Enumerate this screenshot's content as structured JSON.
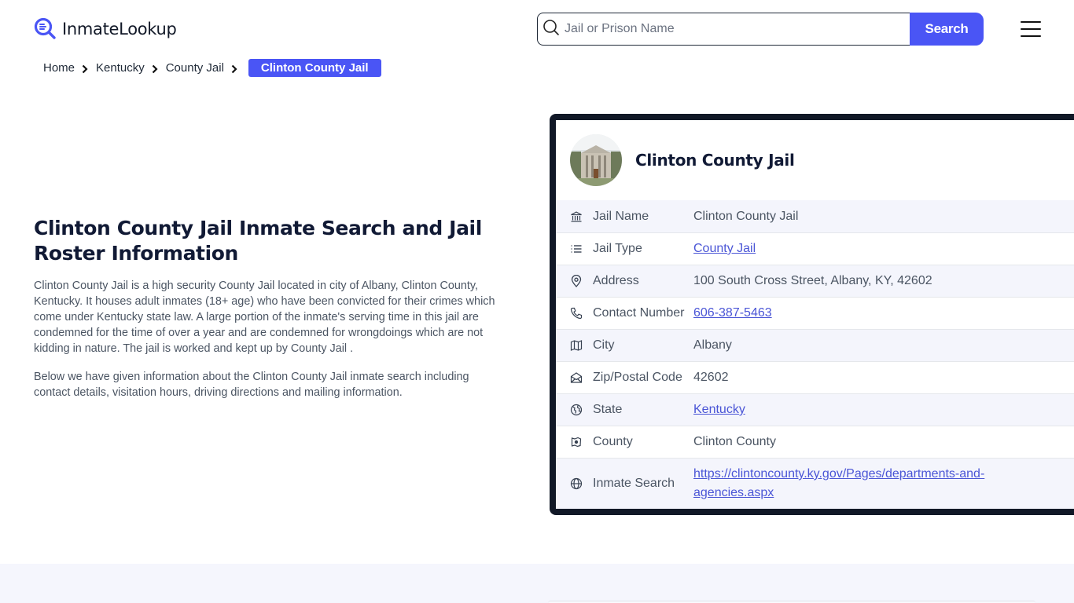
{
  "header": {
    "logo_text": "InmateLookup",
    "search": {
      "placeholder": "Jail or Prison Name",
      "value": "",
      "button_label": "Search"
    },
    "menu_icon": "hamburger-menu-icon"
  },
  "breadcrumb": {
    "items": [
      {
        "label": "Home"
      },
      {
        "label": "Kentucky"
      },
      {
        "label": "County Jail"
      }
    ],
    "current": "Clinton County Jail"
  },
  "main": {
    "title": "Clinton County Jail Inmate Search and Jail Roster Information",
    "paragraphs": [
      "Clinton County Jail is a high security County Jail located in city of Albany, Clinton County, Kentucky. It houses adult inmates (18+ age) who have been convicted for their crimes which come under Kentucky state law. A large portion of the inmate's serving time in this jail are condemned for the time of over a year and are condemned for wrongdoings which are not kidding in nature. The jail is worked and kept up by County Jail .",
      "Below we have given information about the Clinton County Jail inmate search including contact details, visitation hours, driving directions and mailing information."
    ]
  },
  "card": {
    "title": "Clinton County Jail",
    "rows": [
      {
        "icon": "building-icon",
        "label": "Jail Name",
        "value": "Clinton County Jail",
        "link": false
      },
      {
        "icon": "list-icon",
        "label": "Jail Type",
        "value": "County Jail",
        "link": true
      },
      {
        "icon": "map-pin-icon",
        "label": "Address",
        "value": "100 South Cross Street, Albany, KY, 42602",
        "link": false
      },
      {
        "icon": "phone-icon",
        "label": "Contact Number",
        "value": "606-387-5463",
        "link": true
      },
      {
        "icon": "map-icon",
        "label": "City",
        "value": "Albany",
        "link": false
      },
      {
        "icon": "mail-icon",
        "label": "Zip/Postal Code",
        "value": "42602",
        "link": false
      },
      {
        "icon": "globe-alt-icon",
        "label": "State",
        "value": "Kentucky",
        "link": true
      },
      {
        "icon": "county-map-icon",
        "label": "County",
        "value": "Clinton County",
        "link": false
      },
      {
        "icon": "globe-icon",
        "label": "Inmate Search",
        "value": "https://clintoncounty.ky.gov/Pages/departments-and-agencies.aspx",
        "link": true
      }
    ]
  },
  "colors": {
    "accent": "#4a55f5",
    "link": "#4a55d6",
    "card_border": "#111827",
    "row_alt": "#f4f5fc",
    "heading": "#111a35"
  }
}
